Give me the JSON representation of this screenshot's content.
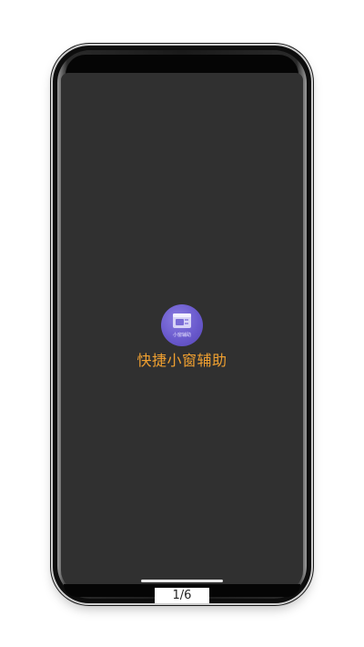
{
  "app": {
    "icon_name": "app-icon",
    "icon_caption": "小窗辅助",
    "label": "快捷小窗辅助",
    "label_color": "#f0a030",
    "icon_color": "#6a5acd"
  },
  "screen": {
    "background": "#303030"
  },
  "pager": {
    "indicator": "1/6"
  }
}
